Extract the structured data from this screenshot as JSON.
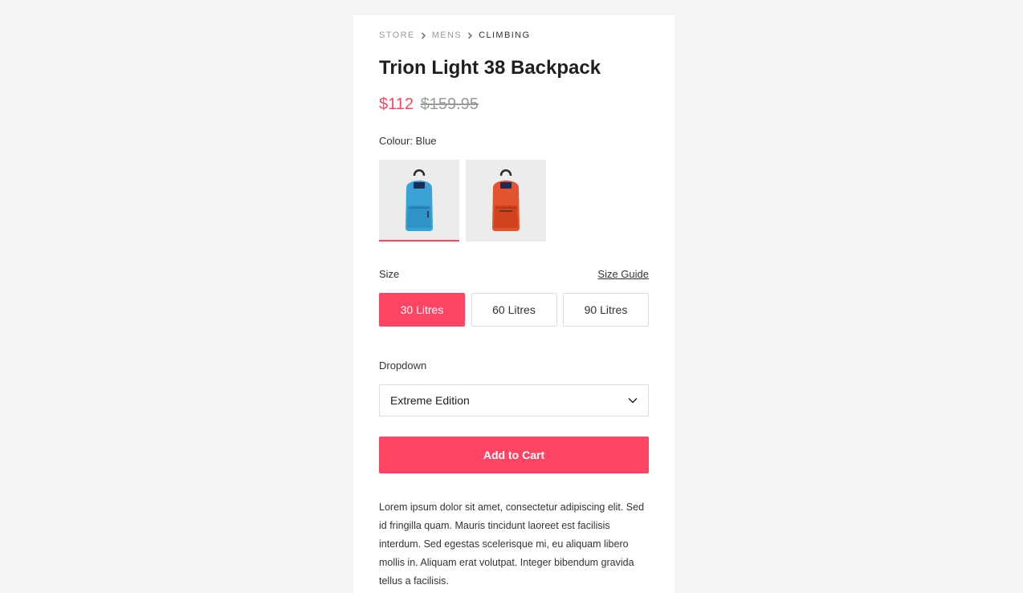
{
  "breadcrumb": {
    "items": [
      "STORE",
      "MENS",
      "CLIMBING"
    ]
  },
  "product": {
    "title": "Trion Light 38 Backpack",
    "price_sale": "$112",
    "price_original": "$159.95",
    "colour_label": "Colour: Blue",
    "colours": [
      {
        "name": "blue-backpack-icon",
        "hex": "#3aa3d6",
        "selected": true
      },
      {
        "name": "red-backpack-icon",
        "hex": "#e4532f",
        "selected": false
      }
    ],
    "size_label": "Size",
    "size_guide_label": "Size Guide",
    "sizes": [
      "30 Litres",
      "60 Litres",
      "90 Litres"
    ],
    "selected_size": "30 Litres",
    "dropdown_label": "Dropdown",
    "dropdown_value": "Extreme Edition",
    "add_to_cart_label": "Add to Cart",
    "description": "Lorem ipsum dolor sit amet, consectetur adipiscing elit. Sed id fringilla quam. Mauris tincidunt laoreet est facilisis interdum. Sed egestas scelerisque mi, eu aliquam libero mollis in. Aliquam erat volutpat. Integer bibendum gravida tellus a facilisis."
  },
  "colors": {
    "accent": "#ff4564",
    "page_background": "#f4f4f4",
    "swatch_background": "#ececec"
  }
}
